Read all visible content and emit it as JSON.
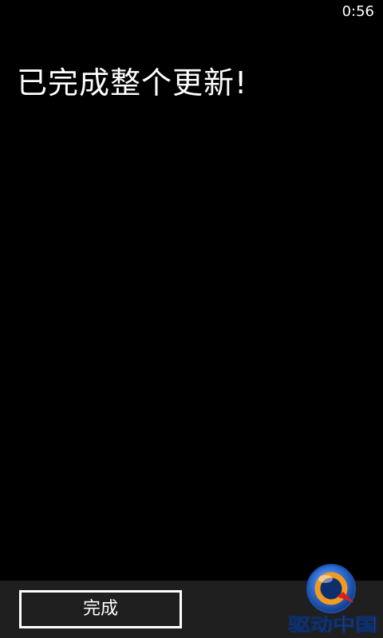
{
  "status_bar": {
    "time": "0:56"
  },
  "main": {
    "title": "已完成整个更新!"
  },
  "app_bar": {
    "done_label": "完成"
  },
  "watermark": {
    "text": "驱动中国",
    "icon": "driver-china-logo-icon"
  },
  "colors": {
    "background": "#000000",
    "app_bar": "#1f1f1f",
    "text": "#ffffff",
    "logo_blue": "#2f6fd6",
    "logo_orange": "#f29b1f",
    "logo_red": "#d92020"
  }
}
